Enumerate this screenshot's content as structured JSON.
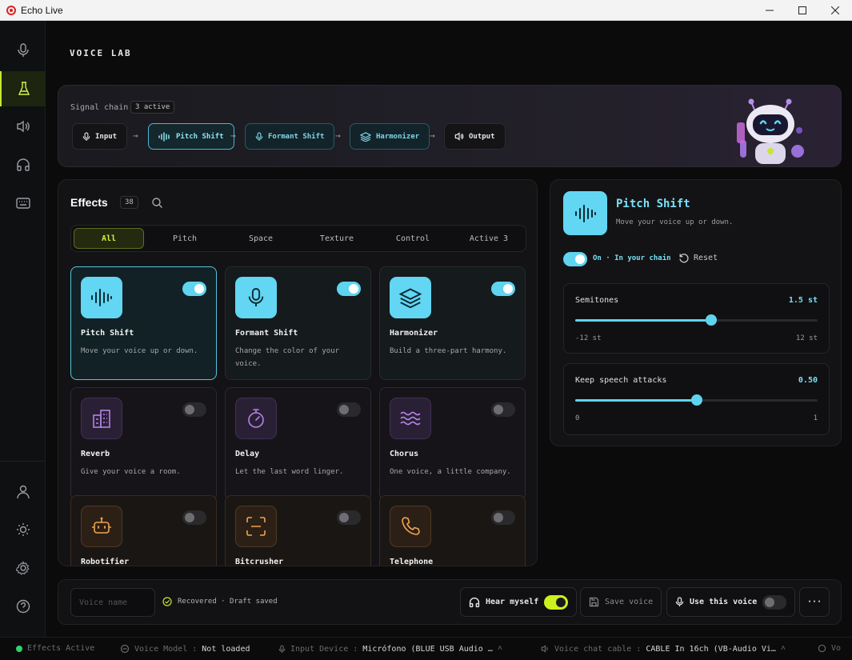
{
  "window": {
    "title": "Echo Live"
  },
  "page": {
    "title": "VOICE LAB"
  },
  "chain": {
    "label": "Signal chain",
    "badge": "3 active",
    "nodes": [
      {
        "label": "Input"
      },
      {
        "label": "Pitch Shift"
      },
      {
        "label": "Formant Shift"
      },
      {
        "label": "Harmonizer"
      },
      {
        "label": "Output"
      }
    ]
  },
  "effects": {
    "title": "Effects",
    "count": "38",
    "tabs": [
      "All",
      "Pitch",
      "Space",
      "Texture",
      "Control",
      "Active 3"
    ],
    "cards": [
      {
        "title": "Pitch Shift",
        "desc": "Move your voice up or down.",
        "enabled": true
      },
      {
        "title": "Formant Shift",
        "desc": "Change the color of your voice.",
        "enabled": true
      },
      {
        "title": "Harmonizer",
        "desc": "Build a three-part harmony.",
        "enabled": true
      },
      {
        "title": "Reverb",
        "desc": "Give your voice a room.",
        "enabled": false
      },
      {
        "title": "Delay",
        "desc": "Let the last word linger.",
        "enabled": false
      },
      {
        "title": "Chorus",
        "desc": "One voice, a little company.",
        "enabled": false
      },
      {
        "title": "Robotifier",
        "desc": "",
        "enabled": false
      },
      {
        "title": "Bitcrusher",
        "desc": "",
        "enabled": false
      },
      {
        "title": "Telephone",
        "desc": "",
        "enabled": false
      }
    ]
  },
  "detail": {
    "title": "Pitch Shift",
    "desc": "Move your voice up or down.",
    "state": "On · In your chain",
    "reset": "Reset",
    "params": [
      {
        "label": "Semitones",
        "value": "1.5 st",
        "min": "-12 st",
        "max": "12 st",
        "fraction": 0.5625
      },
      {
        "label": "Keep speech attacks",
        "value": "0.50",
        "min": "0",
        "max": "1",
        "fraction": 0.5
      }
    ]
  },
  "bottom": {
    "voice_name_placeholder": "Voice name",
    "status": "Recovered · Draft saved",
    "hear_myself": "Hear myself",
    "save_voice": "Save voice",
    "use_voice": "Use this voice",
    "more": "···"
  },
  "statusbar": {
    "effects": "Effects Active",
    "model_label": "Voice Model :",
    "model_value": "Not loaded",
    "input_label": "Input Device :",
    "input_value": "Micrófono (BLUE USB Audio …",
    "cable_label": "Voice chat cable :",
    "cable_value": "CABLE In 16ch (VB-Audio Vi…",
    "extra": "Vo"
  },
  "colors": {
    "accent_cyan": "#5fd4ef",
    "accent_lime": "#cbf21f",
    "purple": "#b483e6",
    "orange": "#f0a450"
  }
}
